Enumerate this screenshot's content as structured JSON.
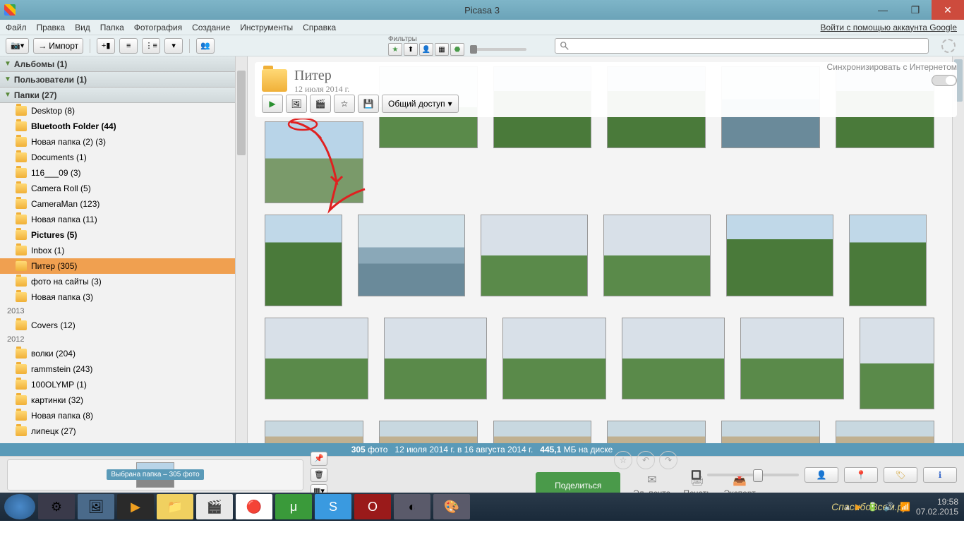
{
  "titlebar": {
    "title": "Picasa 3"
  },
  "menubar": {
    "items": [
      "Файл",
      "Правка",
      "Вид",
      "Папка",
      "Фотография",
      "Создание",
      "Инструменты",
      "Справка"
    ],
    "login": "Войти с помощью аккаунта Google"
  },
  "toolbar": {
    "import": "Импорт",
    "filters_label": "Фильтры"
  },
  "sidebar": {
    "sections": [
      {
        "label": "Альбомы (1)"
      },
      {
        "label": "Пользователи (1)"
      },
      {
        "label": "Папки (27)"
      }
    ],
    "folders": [
      {
        "name": "Desktop (8)"
      },
      {
        "name": "Bluetooth Folder (44)",
        "bold": true
      },
      {
        "name": "Новая папка (2) (3)"
      },
      {
        "name": "Documents (1)"
      },
      {
        "name": "116___09 (3)"
      },
      {
        "name": "Camera Roll (5)"
      },
      {
        "name": "CameraMan (123)"
      },
      {
        "name": "Новая папка (11)"
      },
      {
        "name": "Pictures (5)",
        "bold": true
      },
      {
        "name": "Inbox (1)"
      },
      {
        "name": "Питер (305)",
        "selected": true
      },
      {
        "name": "фото на сайты (3)"
      },
      {
        "name": "Новая папка (3)"
      }
    ],
    "year1": "2013",
    "folders2": [
      {
        "name": "Covers (12)"
      }
    ],
    "year2": "2012",
    "folders3": [
      {
        "name": "волки (204)"
      },
      {
        "name": "rammstein (243)"
      },
      {
        "name": "100OLYMP (1)"
      },
      {
        "name": "картинки (32)"
      },
      {
        "name": "Новая папка (8)"
      },
      {
        "name": "липецк (27)"
      }
    ]
  },
  "folder_header": {
    "title": "Питер",
    "date": "12 июля 2014 г.",
    "share": "Общий доступ"
  },
  "sync": {
    "label": "Синхронизировать с Интернетом"
  },
  "status": {
    "count": "305",
    "count_label": "фото",
    "dates": "12 июля 2014 г. в 16 августа 2014 г.",
    "size": "445,1",
    "size_label": "МБ на диске"
  },
  "tray": {
    "selection": "Выбрана папка – 305 фото",
    "share": "Поделиться",
    "email": "Эл. почта",
    "print": "Печать",
    "export": "Экспорт"
  },
  "taskbar": {
    "time": "19:58",
    "date": "07.02.2015",
    "watermark": "СпасибоВсем.ру"
  }
}
